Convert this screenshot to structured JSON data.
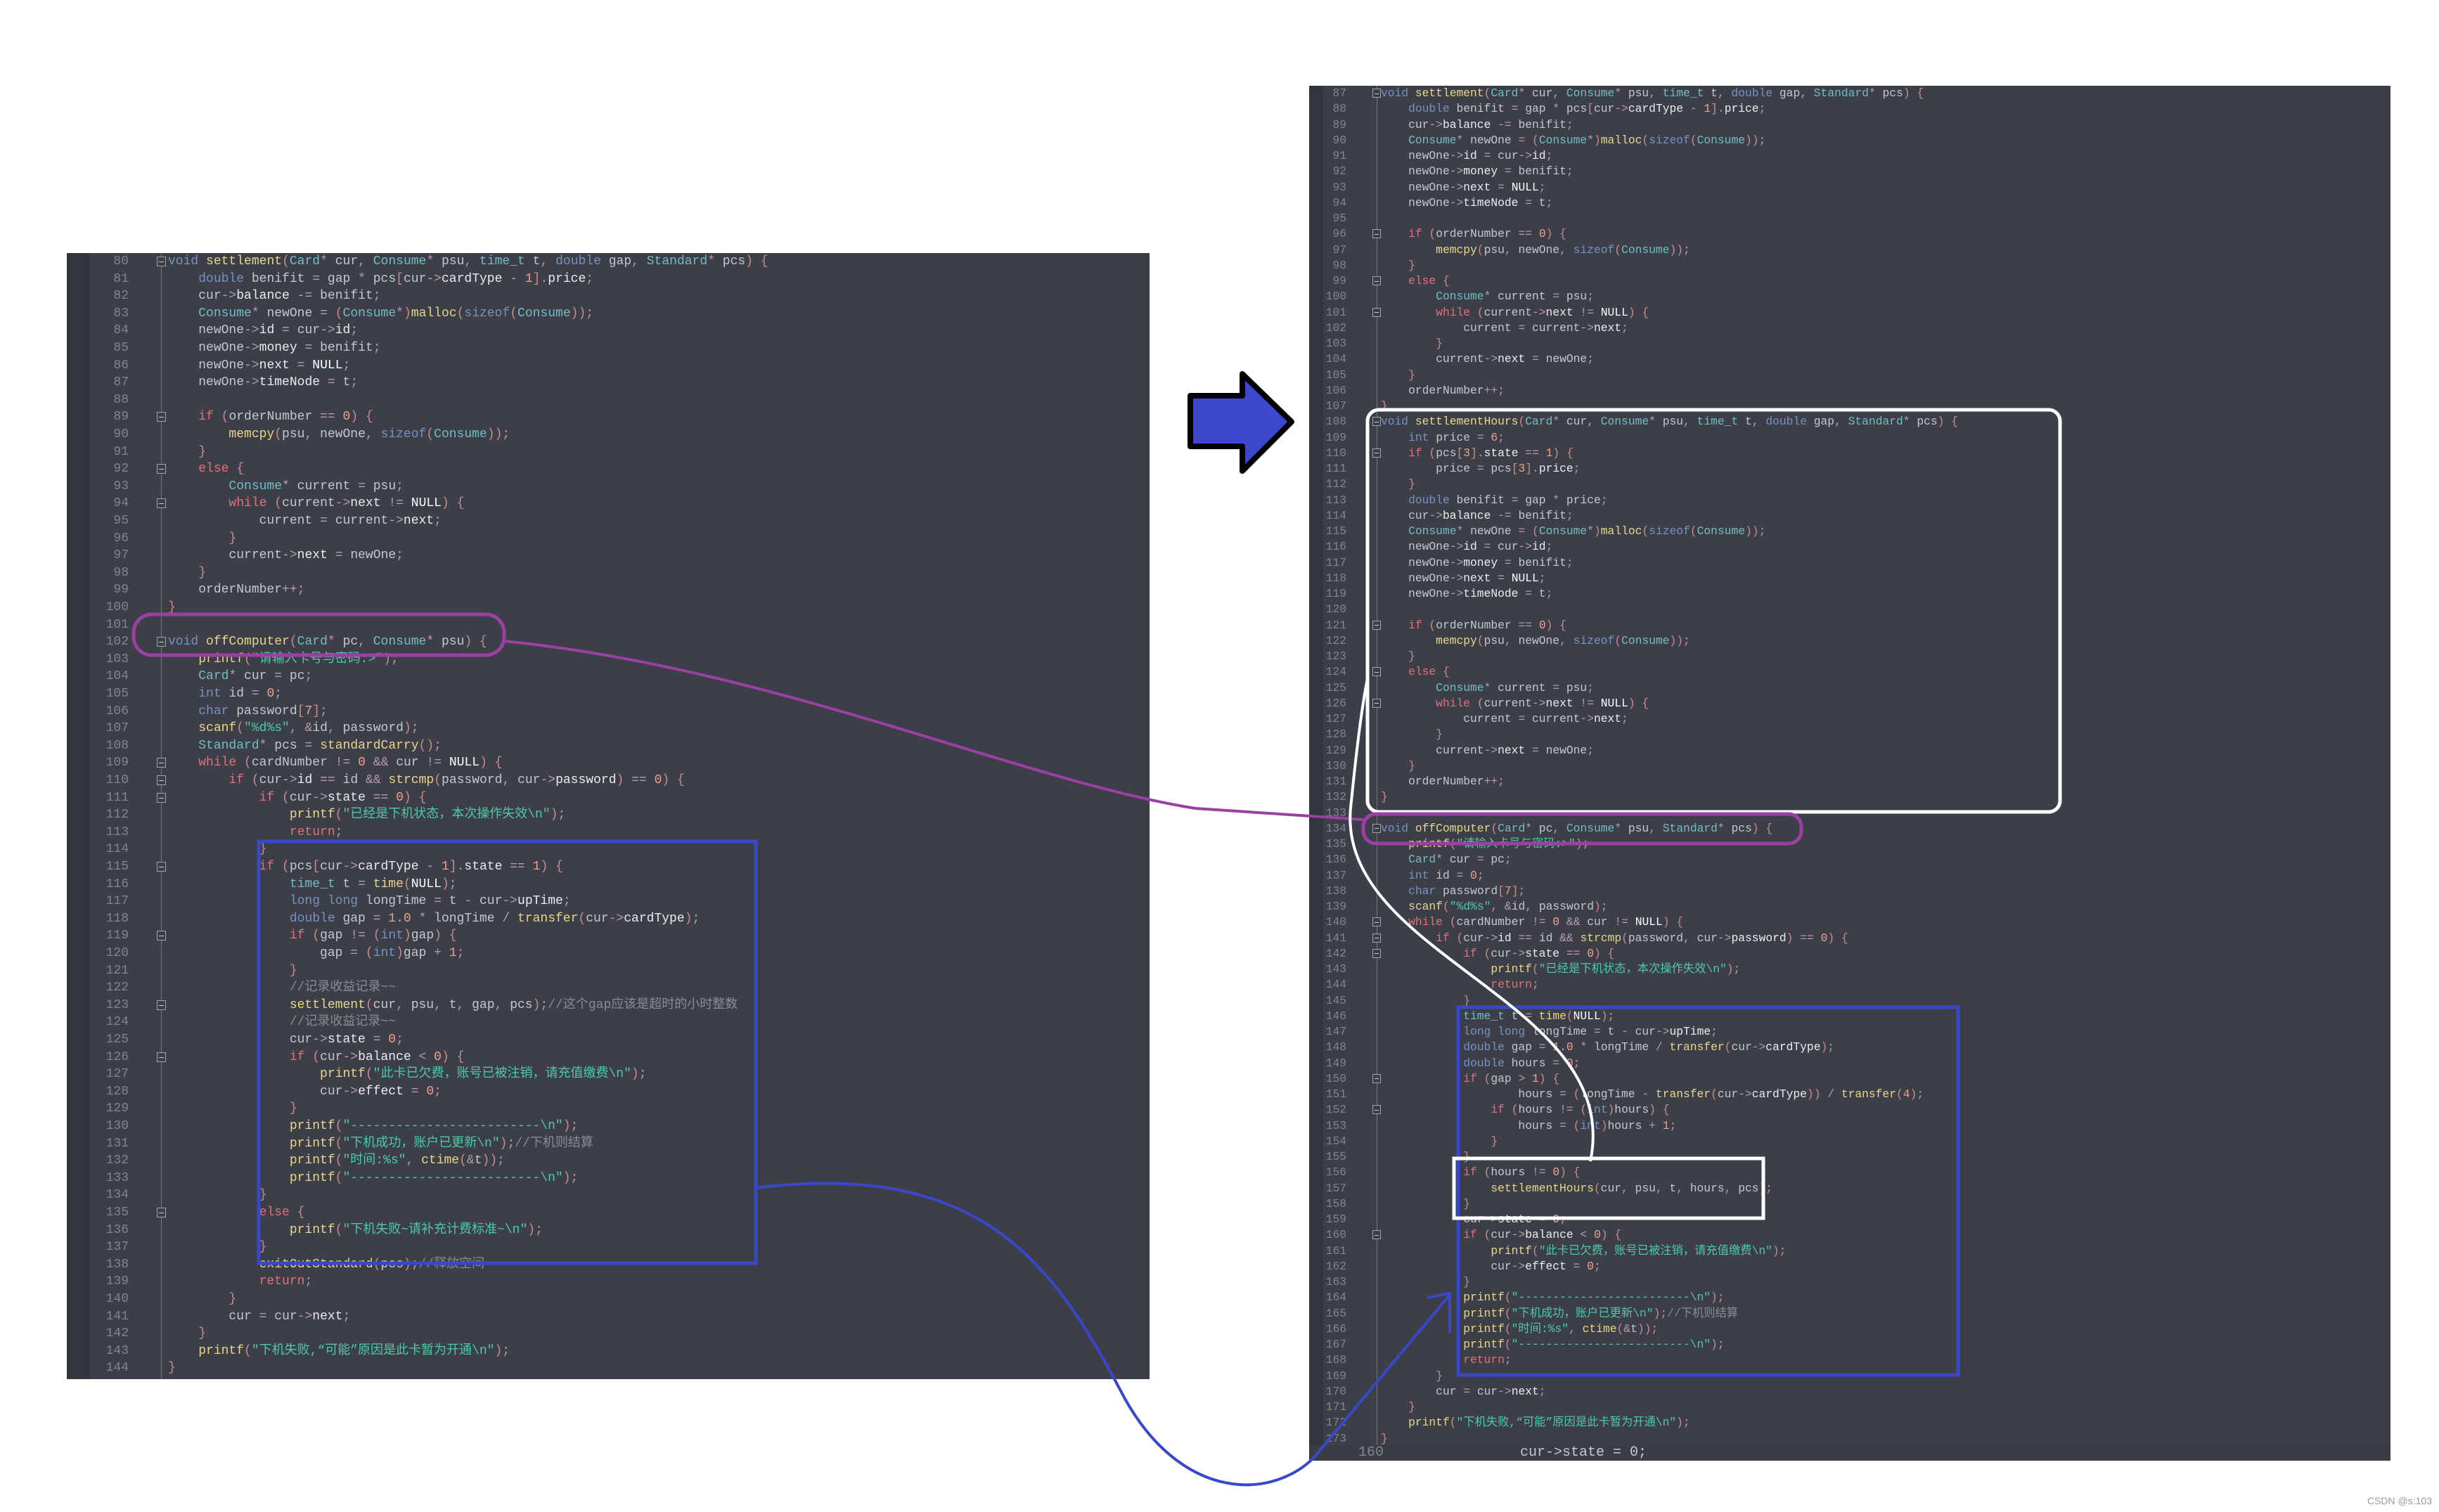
{
  "colors": {
    "editor_bg": "#3c3f47",
    "purple_annotation": "#9b3fa3",
    "blue_annotation": "#3b47c9",
    "white_annotation": "#ffffff",
    "arrow_fill": "#3d48cc"
  },
  "left_editor": {
    "lines": [
      {
        "n": "80",
        "fold": true,
        "text": "void settlement(Card* cur, Consume* psu, time_t t, double gap, Standard* pcs) {"
      },
      {
        "n": "81",
        "text": "    double benifit = gap * pcs[cur->cardType - 1].price;"
      },
      {
        "n": "82",
        "text": "    cur->balance -= benifit;"
      },
      {
        "n": "83",
        "text": "    Consume* newOne = (Consume*)malloc(sizeof(Consume));"
      },
      {
        "n": "84",
        "text": "    newOne->id = cur->id;"
      },
      {
        "n": "85",
        "text": "    newOne->money = benifit;"
      },
      {
        "n": "86",
        "text": "    newOne->next = NULL;"
      },
      {
        "n": "87",
        "text": "    newOne->timeNode = t;"
      },
      {
        "n": "88",
        "text": ""
      },
      {
        "n": "89",
        "fold": true,
        "text": "    if (orderNumber == 0) {"
      },
      {
        "n": "90",
        "text": "        memcpy(psu, newOne, sizeof(Consume));"
      },
      {
        "n": "91",
        "text": "    }"
      },
      {
        "n": "92",
        "fold": true,
        "text": "    else {"
      },
      {
        "n": "93",
        "text": "        Consume* current = psu;"
      },
      {
        "n": "94",
        "fold": true,
        "text": "        while (current->next != NULL) {"
      },
      {
        "n": "95",
        "text": "            current = current->next;"
      },
      {
        "n": "96",
        "text": "        }"
      },
      {
        "n": "97",
        "text": "        current->next = newOne;"
      },
      {
        "n": "98",
        "text": "    }"
      },
      {
        "n": "99",
        "text": "    orderNumber++;"
      },
      {
        "n": "100",
        "text": "}"
      },
      {
        "n": "101",
        "text": ""
      },
      {
        "n": "102",
        "fold": true,
        "text": "void offComputer(Card* pc, Consume* psu) {"
      },
      {
        "n": "103",
        "text": "    printf(\"请输入卡号与密码:>\");"
      },
      {
        "n": "104",
        "text": "    Card* cur = pc;"
      },
      {
        "n": "105",
        "text": "    int id = 0;"
      },
      {
        "n": "106",
        "text": "    char password[7];"
      },
      {
        "n": "107",
        "text": "    scanf(\"%d%s\", &id, password);"
      },
      {
        "n": "108",
        "text": "    Standard* pcs = standardCarry();"
      },
      {
        "n": "109",
        "fold": true,
        "text": "    while (cardNumber != 0 && cur != NULL) {"
      },
      {
        "n": "110",
        "fold": true,
        "text": "        if (cur->id == id && strcmp(password, cur->password) == 0) {"
      },
      {
        "n": "111",
        "fold": true,
        "text": "            if (cur->state == 0) {"
      },
      {
        "n": "112",
        "text": "                printf(\"已经是下机状态，本次操作失效\\n\");"
      },
      {
        "n": "113",
        "text": "                return;"
      },
      {
        "n": "114",
        "text": "            }"
      },
      {
        "n": "115",
        "fold": true,
        "text": "            if (pcs[cur->cardType - 1].state == 1) {"
      },
      {
        "n": "116",
        "text": "                time_t t = time(NULL);"
      },
      {
        "n": "117",
        "text": "                long long longTime = t - cur->upTime;"
      },
      {
        "n": "118",
        "text": "                double gap = 1.0 * longTime / transfer(cur->cardType);"
      },
      {
        "n": "119",
        "fold": true,
        "text": "                if (gap != (int)gap) {"
      },
      {
        "n": "120",
        "text": "                    gap = (int)gap + 1;"
      },
      {
        "n": "121",
        "text": "                }"
      },
      {
        "n": "122",
        "text": "                //记录收益记录~~"
      },
      {
        "n": "123",
        "fold": true,
        "text": "                settlement(cur, psu, t, gap, pcs);//这个gap应该是超时的小时整数"
      },
      {
        "n": "124",
        "text": "                //记录收益记录~~"
      },
      {
        "n": "125",
        "text": "                cur->state = 0;"
      },
      {
        "n": "126",
        "fold": true,
        "text": "                if (cur->balance < 0) {"
      },
      {
        "n": "127",
        "text": "                    printf(\"此卡已欠费，账号已被注销，请充值缴费\\n\");"
      },
      {
        "n": "128",
        "text": "                    cur->effect = 0;"
      },
      {
        "n": "129",
        "text": "                }"
      },
      {
        "n": "130",
        "text": "                printf(\"-------------------------\\n\");"
      },
      {
        "n": "131",
        "text": "                printf(\"下机成功，账户已更新\\n\");//下机则结算"
      },
      {
        "n": "132",
        "text": "                printf(\"时间:%s\", ctime(&t));"
      },
      {
        "n": "133",
        "text": "                printf(\"-------------------------\\n\");"
      },
      {
        "n": "134",
        "text": "            }"
      },
      {
        "n": "135",
        "fold": true,
        "text": "            else {"
      },
      {
        "n": "136",
        "text": "                printf(\"下机失败~请补充计费标准~\\n\");"
      },
      {
        "n": "137",
        "text": "            }"
      },
      {
        "n": "138",
        "text": "            exitOutStandard(pcs);//释放空间"
      },
      {
        "n": "139",
        "text": "            return;"
      },
      {
        "n": "140",
        "text": "        }"
      },
      {
        "n": "141",
        "text": "        cur = cur->next;"
      },
      {
        "n": "142",
        "text": "    }"
      },
      {
        "n": "143",
        "text": "    printf(\"下机失败,“可能”原因是此卡暂为开通\\n\");"
      },
      {
        "n": "144",
        "text": "}"
      }
    ]
  },
  "right_editor": {
    "lines": [
      {
        "n": "87",
        "fold": true,
        "text": "void settlement(Card* cur, Consume* psu, time_t t, double gap, Standard* pcs) {"
      },
      {
        "n": "88",
        "text": "    double benifit = gap * pcs[cur->cardType - 1].price;"
      },
      {
        "n": "89",
        "text": "    cur->balance -= benifit;"
      },
      {
        "n": "90",
        "text": "    Consume* newOne = (Consume*)malloc(sizeof(Consume));"
      },
      {
        "n": "91",
        "text": "    newOne->id = cur->id;"
      },
      {
        "n": "92",
        "text": "    newOne->money = benifit;"
      },
      {
        "n": "93",
        "text": "    newOne->next = NULL;"
      },
      {
        "n": "94",
        "text": "    newOne->timeNode = t;"
      },
      {
        "n": "95",
        "text": ""
      },
      {
        "n": "96",
        "fold": true,
        "text": "    if (orderNumber == 0) {"
      },
      {
        "n": "97",
        "text": "        memcpy(psu, newOne, sizeof(Consume));"
      },
      {
        "n": "98",
        "text": "    }"
      },
      {
        "n": "99",
        "fold": true,
        "text": "    else {"
      },
      {
        "n": "100",
        "text": "        Consume* current = psu;"
      },
      {
        "n": "101",
        "fold": true,
        "text": "        while (current->next != NULL) {"
      },
      {
        "n": "102",
        "text": "            current = current->next;"
      },
      {
        "n": "103",
        "text": "        }"
      },
      {
        "n": "104",
        "text": "        current->next = newOne;"
      },
      {
        "n": "105",
        "text": "    }"
      },
      {
        "n": "106",
        "text": "    orderNumber++;"
      },
      {
        "n": "107",
        "text": "}"
      },
      {
        "n": "108",
        "fold": true,
        "text": "void settlementHours(Card* cur, Consume* psu, time_t t, double gap, Standard* pcs) {"
      },
      {
        "n": "109",
        "text": "    int price = 6;"
      },
      {
        "n": "110",
        "fold": true,
        "text": "    if (pcs[3].state == 1) {"
      },
      {
        "n": "111",
        "text": "        price = pcs[3].price;"
      },
      {
        "n": "112",
        "text": "    }"
      },
      {
        "n": "113",
        "text": "    double benifit = gap * price;"
      },
      {
        "n": "114",
        "text": "    cur->balance -= benifit;"
      },
      {
        "n": "115",
        "text": "    Consume* newOne = (Consume*)malloc(sizeof(Consume));"
      },
      {
        "n": "116",
        "text": "    newOne->id = cur->id;"
      },
      {
        "n": "117",
        "text": "    newOne->money = benifit;"
      },
      {
        "n": "118",
        "text": "    newOne->next = NULL;"
      },
      {
        "n": "119",
        "text": "    newOne->timeNode = t;"
      },
      {
        "n": "120",
        "text": ""
      },
      {
        "n": "121",
        "fold": true,
        "text": "    if (orderNumber == 0) {"
      },
      {
        "n": "122",
        "text": "        memcpy(psu, newOne, sizeof(Consume));"
      },
      {
        "n": "123",
        "text": "    }"
      },
      {
        "n": "124",
        "fold": true,
        "text": "    else {"
      },
      {
        "n": "125",
        "text": "        Consume* current = psu;"
      },
      {
        "n": "126",
        "fold": true,
        "text": "        while (current->next != NULL) {"
      },
      {
        "n": "127",
        "text": "            current = current->next;"
      },
      {
        "n": "128",
        "text": "        }"
      },
      {
        "n": "129",
        "text": "        current->next = newOne;"
      },
      {
        "n": "130",
        "text": "    }"
      },
      {
        "n": "131",
        "text": "    orderNumber++;"
      },
      {
        "n": "132",
        "text": "}"
      },
      {
        "n": "133",
        "text": ""
      },
      {
        "n": "134",
        "fold": true,
        "text": "void offComputer(Card* pc, Consume* psu, Standard* pcs) {"
      },
      {
        "n": "135",
        "text": "    printf(\"请输入卡号与密码:>\");"
      },
      {
        "n": "136",
        "text": "    Card* cur = pc;"
      },
      {
        "n": "137",
        "text": "    int id = 0;"
      },
      {
        "n": "138",
        "text": "    char password[7];"
      },
      {
        "n": "139",
        "text": "    scanf(\"%d%s\", &id, password);"
      },
      {
        "n": "140",
        "fold": true,
        "text": "    while (cardNumber != 0 && cur != NULL) {"
      },
      {
        "n": "141",
        "fold": true,
        "text": "        if (cur->id == id && strcmp(password, cur->password) == 0) {"
      },
      {
        "n": "142",
        "fold": true,
        "text": "            if (cur->state == 0) {"
      },
      {
        "n": "143",
        "text": "                printf(\"已经是下机状态，本次操作失效\\n\");"
      },
      {
        "n": "144",
        "text": "                return;"
      },
      {
        "n": "145",
        "text": "            }"
      },
      {
        "n": "146",
        "text": "            time_t t = time(NULL);"
      },
      {
        "n": "147",
        "text": "            long long longTime = t - cur->upTime;"
      },
      {
        "n": "148",
        "text": "            double gap = 1.0 * longTime / transfer(cur->cardType);"
      },
      {
        "n": "149",
        "text": "            double hours = 0;"
      },
      {
        "n": "150",
        "fold": true,
        "text": "            if (gap > 1) {"
      },
      {
        "n": "151",
        "text": "                    hours = (longTime - transfer(cur->cardType)) / transfer(4);"
      },
      {
        "n": "152",
        "fold": true,
        "text": "                if (hours != (int)hours) {"
      },
      {
        "n": "153",
        "text": "                    hours = (int)hours + 1;"
      },
      {
        "n": "154",
        "text": "                }"
      },
      {
        "n": "155",
        "text": "            }"
      },
      {
        "n": "156",
        "text": "            if (hours != 0) {"
      },
      {
        "n": "157",
        "text": "                settlementHours(cur, psu, t, hours, pcs);"
      },
      {
        "n": "158",
        "text": "            }"
      },
      {
        "n": "159",
        "text": "            cur->state = 0;"
      },
      {
        "n": "160",
        "fold": true,
        "text": "            if (cur->balance < 0) {"
      },
      {
        "n": "161",
        "text": "                printf(\"此卡已欠费，账号已被注销，请充值缴费\\n\");"
      },
      {
        "n": "162",
        "text": "                cur->effect = 0;"
      },
      {
        "n": "163",
        "text": "            }"
      },
      {
        "n": "164",
        "text": "            printf(\"-------------------------\\n\");"
      },
      {
        "n": "165",
        "text": "            printf(\"下机成功，账户已更新\\n\");//下机则结算"
      },
      {
        "n": "166",
        "text": "            printf(\"时间:%s\", ctime(&t));"
      },
      {
        "n": "167",
        "text": "            printf(\"-------------------------\\n\");"
      },
      {
        "n": "168",
        "text": "            return;"
      },
      {
        "n": "169",
        "text": "        }"
      },
      {
        "n": "170",
        "text": "        cur = cur->next;"
      },
      {
        "n": "171",
        "text": "    }"
      },
      {
        "n": "172",
        "text": "    printf(\"下机失败,“可能”原因是此卡暂为开通\\n\");"
      },
      {
        "n": "173",
        "text": "}"
      }
    ],
    "bottom_strip": {
      "n": "160",
      "text": "cur->state = 0;"
    }
  },
  "watermark": "CSDN @s:103"
}
